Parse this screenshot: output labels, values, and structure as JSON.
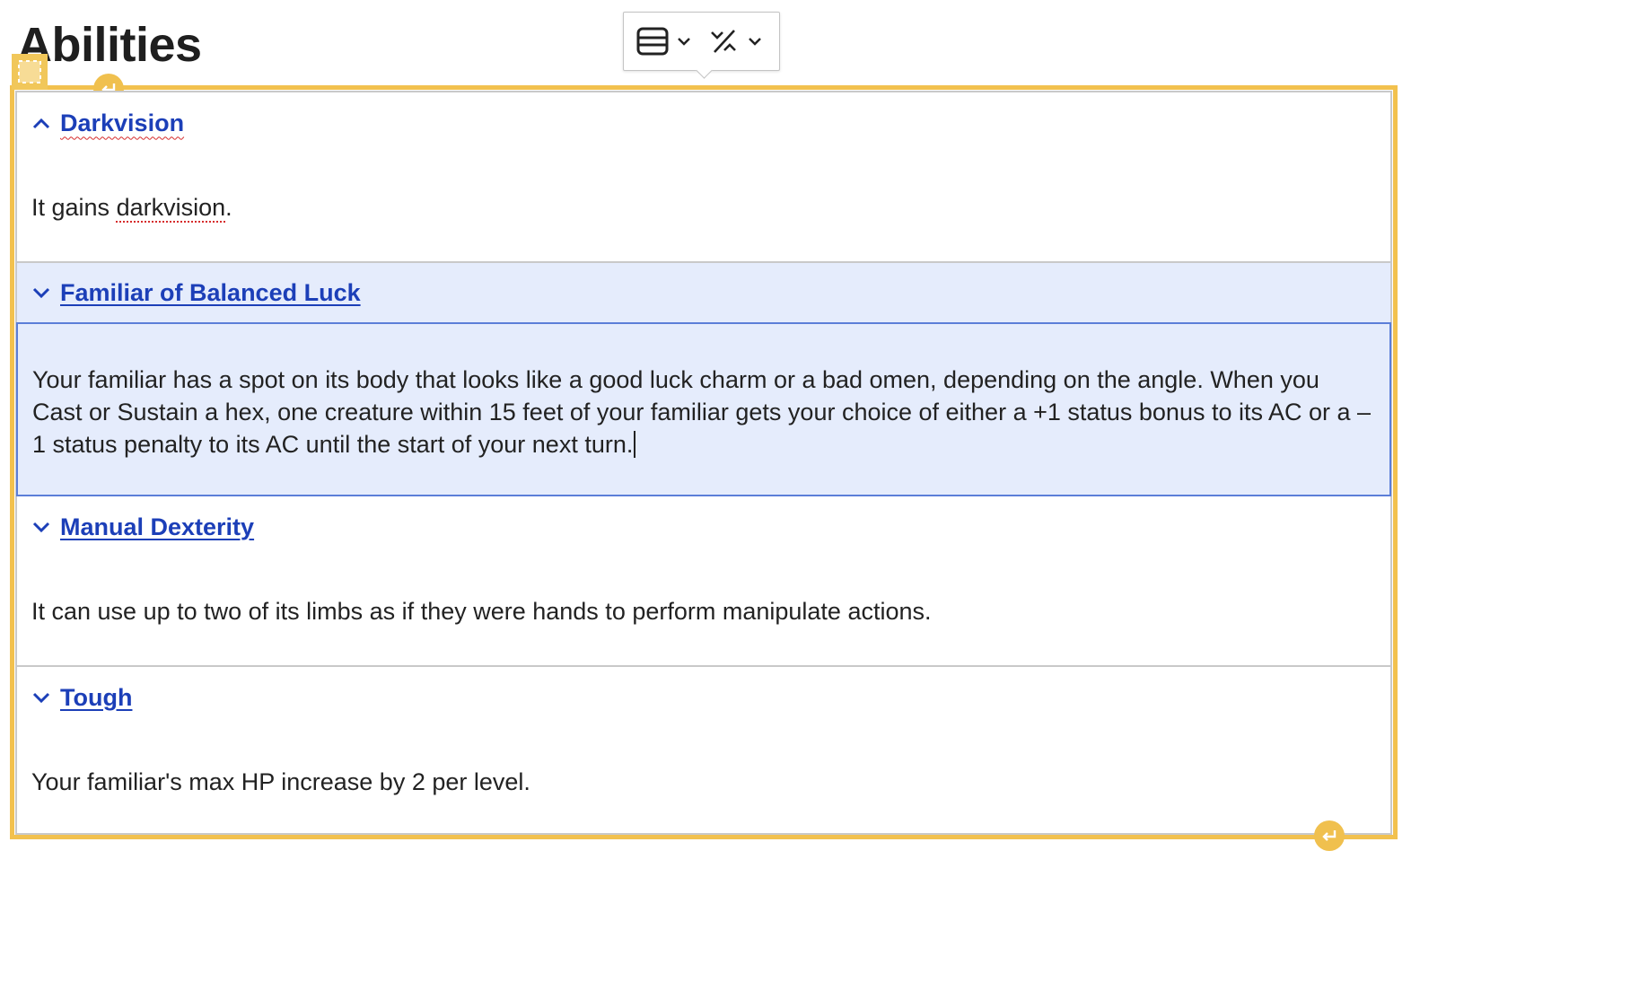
{
  "page": {
    "title": "Abilities"
  },
  "toolbar": {
    "buttons": [
      {
        "icon": "accordion-layout-icon"
      },
      {
        "icon": "remove-format-icon"
      }
    ]
  },
  "accordion": {
    "items": [
      {
        "title": "Darkvision",
        "expanded": true,
        "body_parts": [
          "It gains ",
          "darkvision",
          "."
        ]
      },
      {
        "title": "Familiar of Balanced Luck",
        "expanded": false,
        "active": true,
        "body": "Your familiar has a spot on its body that looks like a good luck charm or a bad omen, depending on the angle. When you Cast or Sustain a hex, one creature within 15 feet of your familiar gets your choice of either a +1 status bonus to its AC or a –1 status penalty to its AC until the start of your next turn."
      },
      {
        "title": "Manual Dexterity",
        "expanded": false,
        "body": "It can use up to two of its limbs as if they were hands to perform manipulate actions."
      },
      {
        "title": "Tough",
        "expanded": false,
        "body": "Your familiar's max HP increase by 2 per level."
      }
    ]
  },
  "colors": {
    "selection": "#f2c14e",
    "link": "#1c3fb8",
    "active_bg": "#e5ecfc",
    "active_border": "#5b7ed8",
    "divider": "#c9c9c9"
  }
}
